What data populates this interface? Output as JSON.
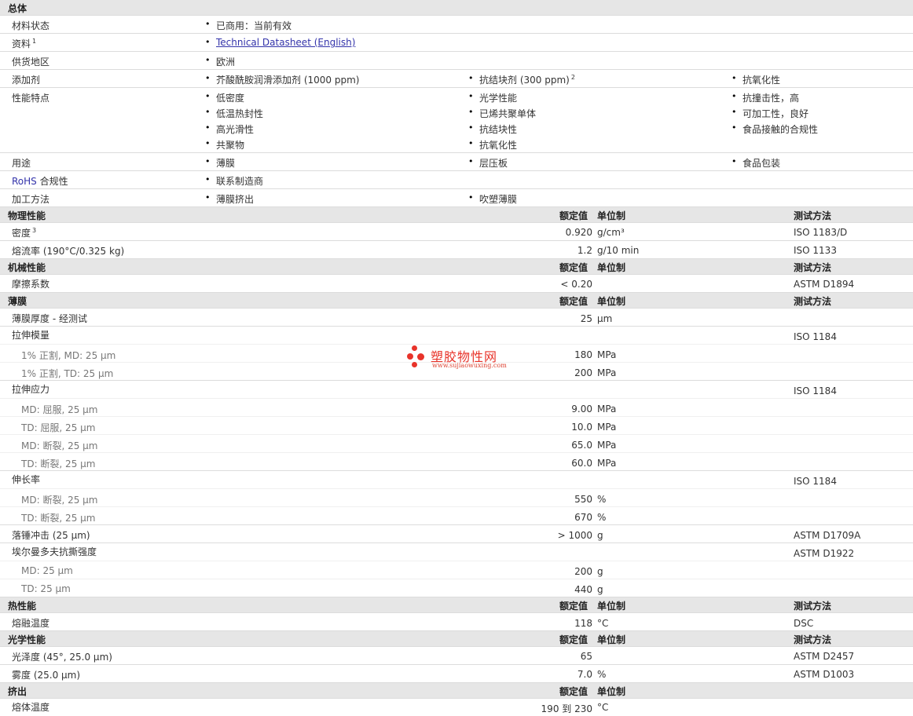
{
  "overview": {
    "header": "总体",
    "material_status": {
      "label": "材料状态",
      "value": "已商用：当前有效"
    },
    "docs": {
      "label": "资料",
      "sup": "1",
      "link": "Technical Datasheet (English)"
    },
    "region": {
      "label": "供货地区",
      "value": "欧洲"
    },
    "additives": {
      "label": "添加剂",
      "items": [
        "芥酸酰胺润滑添加剂 (1000 ppm)",
        "抗结块剂 (300 ppm)",
        "抗氧化性"
      ],
      "sup2": "2"
    },
    "features": {
      "label": "性能特点",
      "items": [
        "低密度",
        "光学性能",
        "抗撞击性，高",
        "低温热封性",
        "已烯共聚单体",
        "可加工性，良好",
        "高光滑性",
        "抗结块性",
        "食品接触的合规性",
        "共聚物",
        "抗氧化性"
      ]
    },
    "uses": {
      "label": "用途",
      "items": [
        "薄膜",
        "层压板",
        "食品包装"
      ]
    },
    "rohs": {
      "label_en": "RoHS",
      "label_cn": "合规性",
      "value": "联系制造商"
    },
    "processing": {
      "label": "加工方法",
      "items": [
        "薄膜挤出",
        "吹塑薄膜"
      ]
    }
  },
  "col_headers": {
    "value": "额定值",
    "unit": "单位制",
    "method": "测试方法"
  },
  "physical": {
    "header": "物理性能",
    "rows": [
      {
        "label": "密度",
        "sup": "3",
        "value": "0.920",
        "unit": "g/cm³",
        "method": "ISO 1183/D"
      },
      {
        "label": "熔流率 (190°C/0.325 kg)",
        "value": "1.2",
        "unit": "g/10 min",
        "method": "ISO 1133"
      }
    ]
  },
  "mechanical": {
    "header": "机械性能",
    "rows": [
      {
        "label": "摩擦系数",
        "value": "< 0.20",
        "unit": "",
        "method": "ASTM D1894"
      }
    ]
  },
  "film": {
    "header": "薄膜",
    "thickness": {
      "label": "薄膜厚度 - 经测试",
      "value": "25",
      "unit": "µm"
    },
    "modulus": {
      "label": "拉伸模量",
      "method": "ISO 1184",
      "rows": [
        {
          "label": "1% 正割, MD: 25 µm",
          "value": "180",
          "unit": "MPa"
        },
        {
          "label": "1% 正割, TD: 25 µm",
          "value": "200",
          "unit": "MPa"
        }
      ]
    },
    "stress": {
      "label": "拉伸应力",
      "method": "ISO 1184",
      "rows": [
        {
          "label": "MD: 屈服, 25 µm",
          "value": "9.00",
          "unit": "MPa"
        },
        {
          "label": "TD: 屈服, 25 µm",
          "value": "10.0",
          "unit": "MPa"
        },
        {
          "label": "MD: 断裂, 25 µm",
          "value": "65.0",
          "unit": "MPa"
        },
        {
          "label": "TD: 断裂, 25 µm",
          "value": "60.0",
          "unit": "MPa"
        }
      ]
    },
    "elongation": {
      "label": "伸长率",
      "method": "ISO 1184",
      "rows": [
        {
          "label": "MD: 断裂, 25 µm",
          "value": "550",
          "unit": "%"
        },
        {
          "label": "TD: 断裂, 25 µm",
          "value": "670",
          "unit": "%"
        }
      ]
    },
    "dart": {
      "label": "落锤冲击 (25 µm)",
      "value": "> 1000",
      "unit": "g",
      "method": "ASTM D1709A"
    },
    "elmendorf": {
      "label": "埃尔曼多夫抗撕强度",
      "method": "ASTM D1922",
      "rows": [
        {
          "label": "MD: 25 µm",
          "value": "200",
          "unit": "g"
        },
        {
          "label": "TD: 25 µm",
          "value": "440",
          "unit": "g"
        }
      ]
    }
  },
  "thermal": {
    "header": "热性能",
    "rows": [
      {
        "label": "熔融温度",
        "value": "118",
        "unit": "°C",
        "method": "DSC"
      }
    ]
  },
  "optical": {
    "header": "光学性能",
    "rows": [
      {
        "label": "光泽度 (45°, 25.0 µm)",
        "value": "65",
        "unit": "",
        "method": "ASTM D2457"
      },
      {
        "label": "雾度 (25.0 µm)",
        "value": "7.0",
        "unit": "%",
        "method": "ASTM D1003"
      }
    ]
  },
  "extrusion": {
    "header": "挤出",
    "rows": [
      {
        "label": "熔体温度",
        "value": "190 到 230",
        "unit": "°C"
      }
    ]
  },
  "watermark": {
    "cn": "塑胶物性网",
    "url": "www.sujiaowuxing.com"
  }
}
